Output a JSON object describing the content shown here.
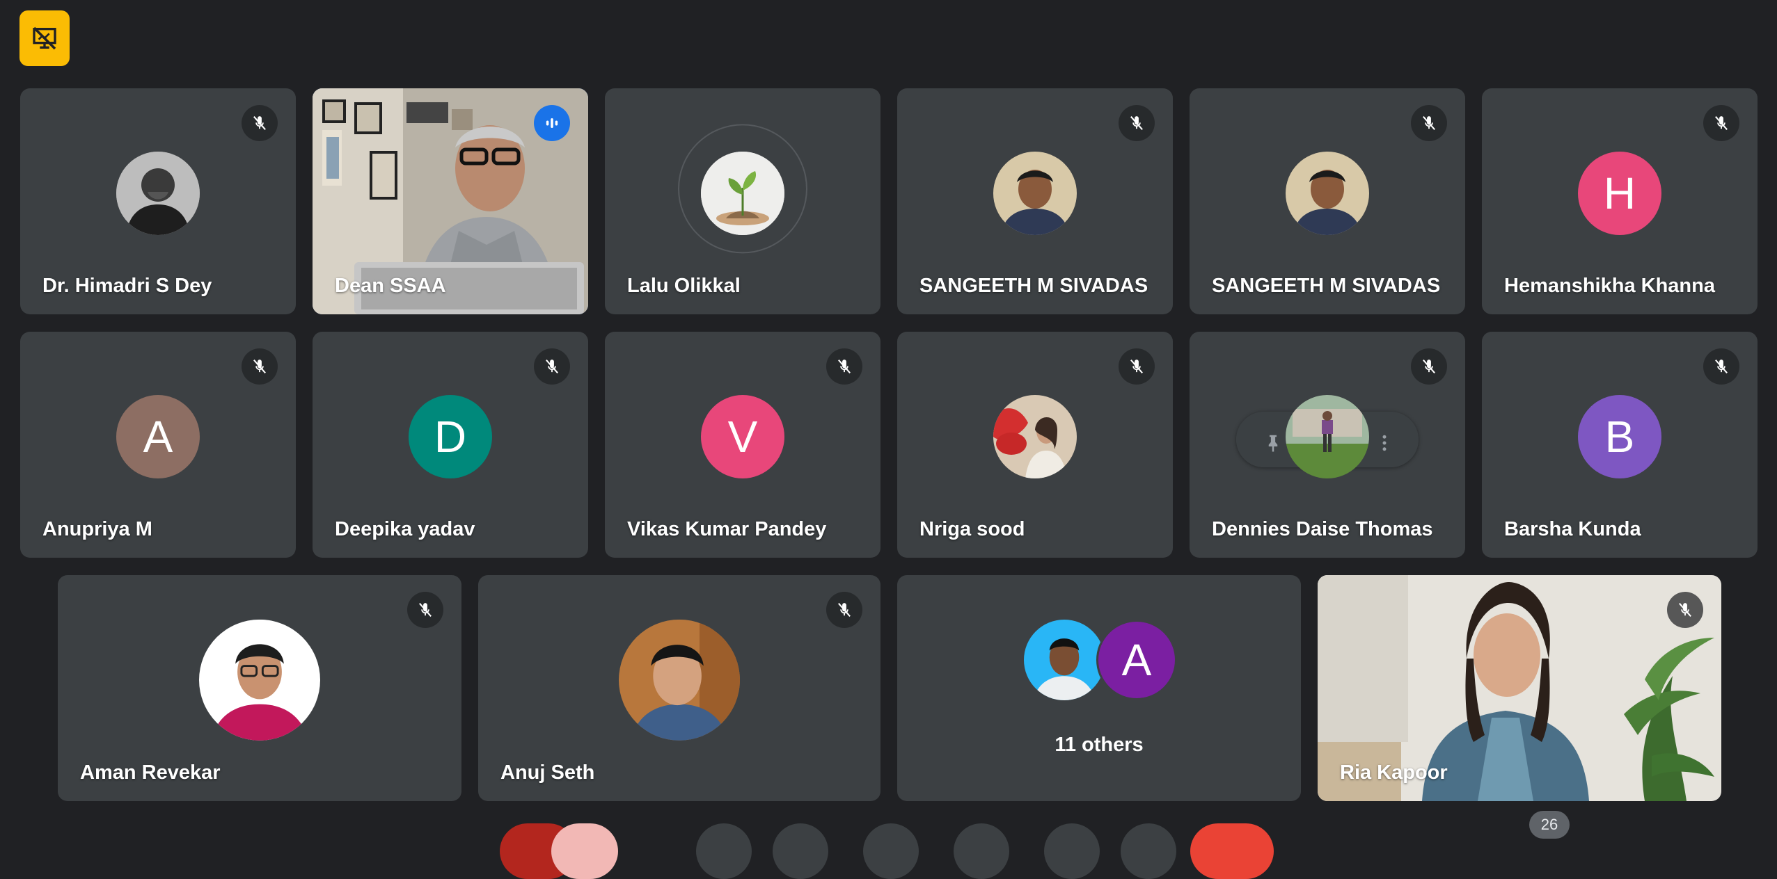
{
  "tiles": {
    "t1": {
      "name": "Dr. Himadri S Dey"
    },
    "t2": {
      "name": "Dean SSAA"
    },
    "t3": {
      "name": "Lalu Olikkal"
    },
    "t4": {
      "name": "SANGEETH M SIVADAS"
    },
    "t5": {
      "name": "SANGEETH M SIVADAS"
    },
    "t6": {
      "name": "Hemanshikha Khanna",
      "initial": "H",
      "color": "#e8477a"
    },
    "t7": {
      "name": "Anupriya M",
      "initial": "A",
      "color": "#8d6e63"
    },
    "t8": {
      "name": "Deepika yadav",
      "initial": "D",
      "color": "#00897b"
    },
    "t9": {
      "name": "Vikas Kumar Pandey",
      "initial": "V",
      "color": "#e8477a"
    },
    "t10": {
      "name": "Nriga sood"
    },
    "t11": {
      "name": "Dennies Daise Thomas"
    },
    "t12": {
      "name": "Barsha Kunda",
      "initial": "B",
      "color": "#7e57c2"
    },
    "t13": {
      "name": "Aman Revekar"
    },
    "t14": {
      "name": "Anuj Seth"
    },
    "t15": {
      "label": "11 others",
      "initial": "A",
      "color": "#7b1fa2"
    },
    "t16": {
      "name": "Ria Kapoor"
    }
  },
  "participant_count": "26",
  "colors": {
    "background": "#202124",
    "tile": "#3c4043",
    "badge": "#fbbc04",
    "speaking_outline": "#8ab4f8",
    "speaking_icon": "#1a73e8"
  },
  "icons": [
    "presentation-off-icon",
    "mic-off-icon",
    "audio-level-icon",
    "pin-icon",
    "more-vert-icon"
  ]
}
